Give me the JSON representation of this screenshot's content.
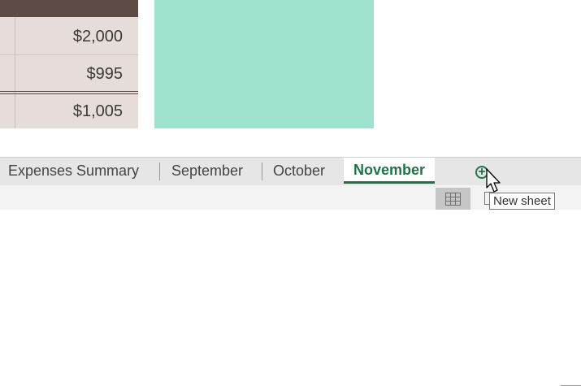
{
  "table": {
    "rows": [
      {
        "value": "$2,000"
      },
      {
        "value": "$995"
      },
      {
        "value": "$1,005"
      }
    ]
  },
  "sheet_tabs": [
    {
      "label": "Expenses Summary",
      "active": false
    },
    {
      "label": "September",
      "active": false
    },
    {
      "label": "October",
      "active": false
    },
    {
      "label": "November",
      "active": true
    }
  ],
  "new_sheet": {
    "icon": "plus-circle-icon",
    "tooltip": "New sheet"
  },
  "status_bar": {
    "views": [
      "normal-view-icon",
      "page-layout-view-icon"
    ]
  },
  "colors": {
    "header_band": "#5e4b45",
    "table_fill": "#e6dcda",
    "shape_fill": "#a0e1d0",
    "accent": "#217346"
  }
}
